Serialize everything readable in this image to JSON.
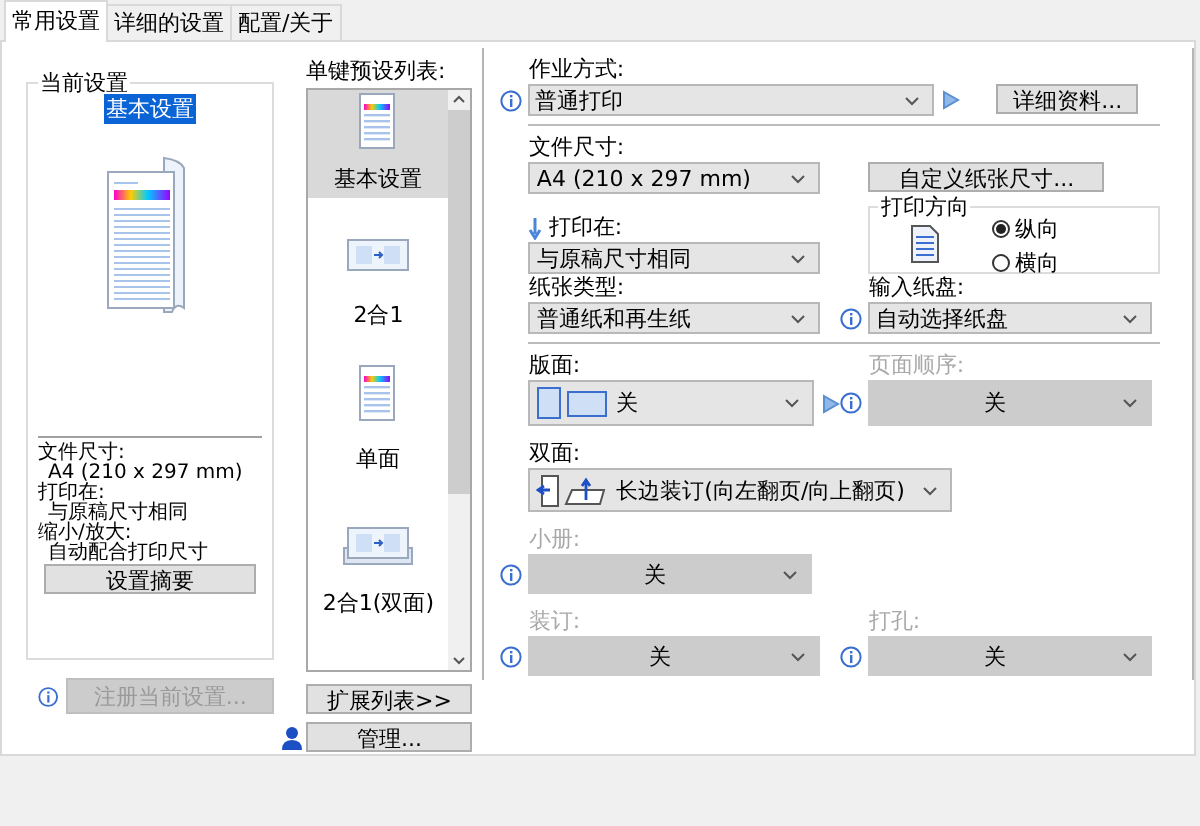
{
  "tabs": [
    {
      "label": "常用设置",
      "selected": true
    },
    {
      "label": "详细的设置",
      "selected": false
    },
    {
      "label": "配置/关于",
      "selected": false
    }
  ],
  "current_settings": {
    "title": "当前设置",
    "preset_name": "基本设置",
    "details": [
      {
        "label": "文件尺寸:",
        "value": "A4 (210 x 297 mm)"
      },
      {
        "label": "打印在:",
        "value": "与原稿尺寸相同"
      },
      {
        "label": "缩小/放大:",
        "value": "自动配合打印尺寸"
      }
    ],
    "summary_button": "设置摘要",
    "register_button": {
      "label": "注册当前设置...",
      "disabled": true
    }
  },
  "presets": {
    "title": "单键预设列表:",
    "items": [
      {
        "label": "基本设置",
        "kind": "page",
        "selected": true
      },
      {
        "label": "2合1",
        "kind": "n-up",
        "selected": false
      },
      {
        "label": "单面",
        "kind": "page",
        "selected": false
      },
      {
        "label": "2合1(双面)",
        "kind": "n-up-duplex",
        "selected": false
      }
    ],
    "expand_button": "扩展列表>>",
    "manage_button": "管理..."
  },
  "settings": {
    "job_mode": {
      "label": "作业方式:",
      "value": "普通打印",
      "disabled": false
    },
    "details_button": "详细资料...",
    "document_size": {
      "label": "文件尺寸:",
      "value": "A4 (210 x 297 mm)",
      "disabled": false
    },
    "custom_size_button": "自定义纸张尺寸...",
    "print_on": {
      "label": "打印在:",
      "value": "与原稿尺寸相同",
      "disabled": false
    },
    "orientation": {
      "title": "打印方向",
      "options": [
        {
          "label": "纵向",
          "selected": true
        },
        {
          "label": "横向",
          "selected": false
        }
      ]
    },
    "paper_type": {
      "label": "纸张类型:",
      "value": "普通纸和再生纸",
      "disabled": false
    },
    "paper_tray": {
      "label": "输入纸盘:",
      "value": "自动选择纸盘",
      "disabled": false
    },
    "layout": {
      "label": "版面:",
      "value": "关",
      "disabled": false
    },
    "page_order": {
      "label": "页面顺序:",
      "value": "关",
      "disabled": true
    },
    "duplex": {
      "label": "双面:",
      "value": "长边装订(向左翻页/向上翻页)",
      "disabled": false
    },
    "booklet": {
      "label": "小册:",
      "value": "关",
      "disabled": true
    },
    "binding": {
      "label": "装订:",
      "value": "关",
      "disabled": true
    },
    "punch": {
      "label": "打孔:",
      "value": "关",
      "disabled": true
    }
  }
}
